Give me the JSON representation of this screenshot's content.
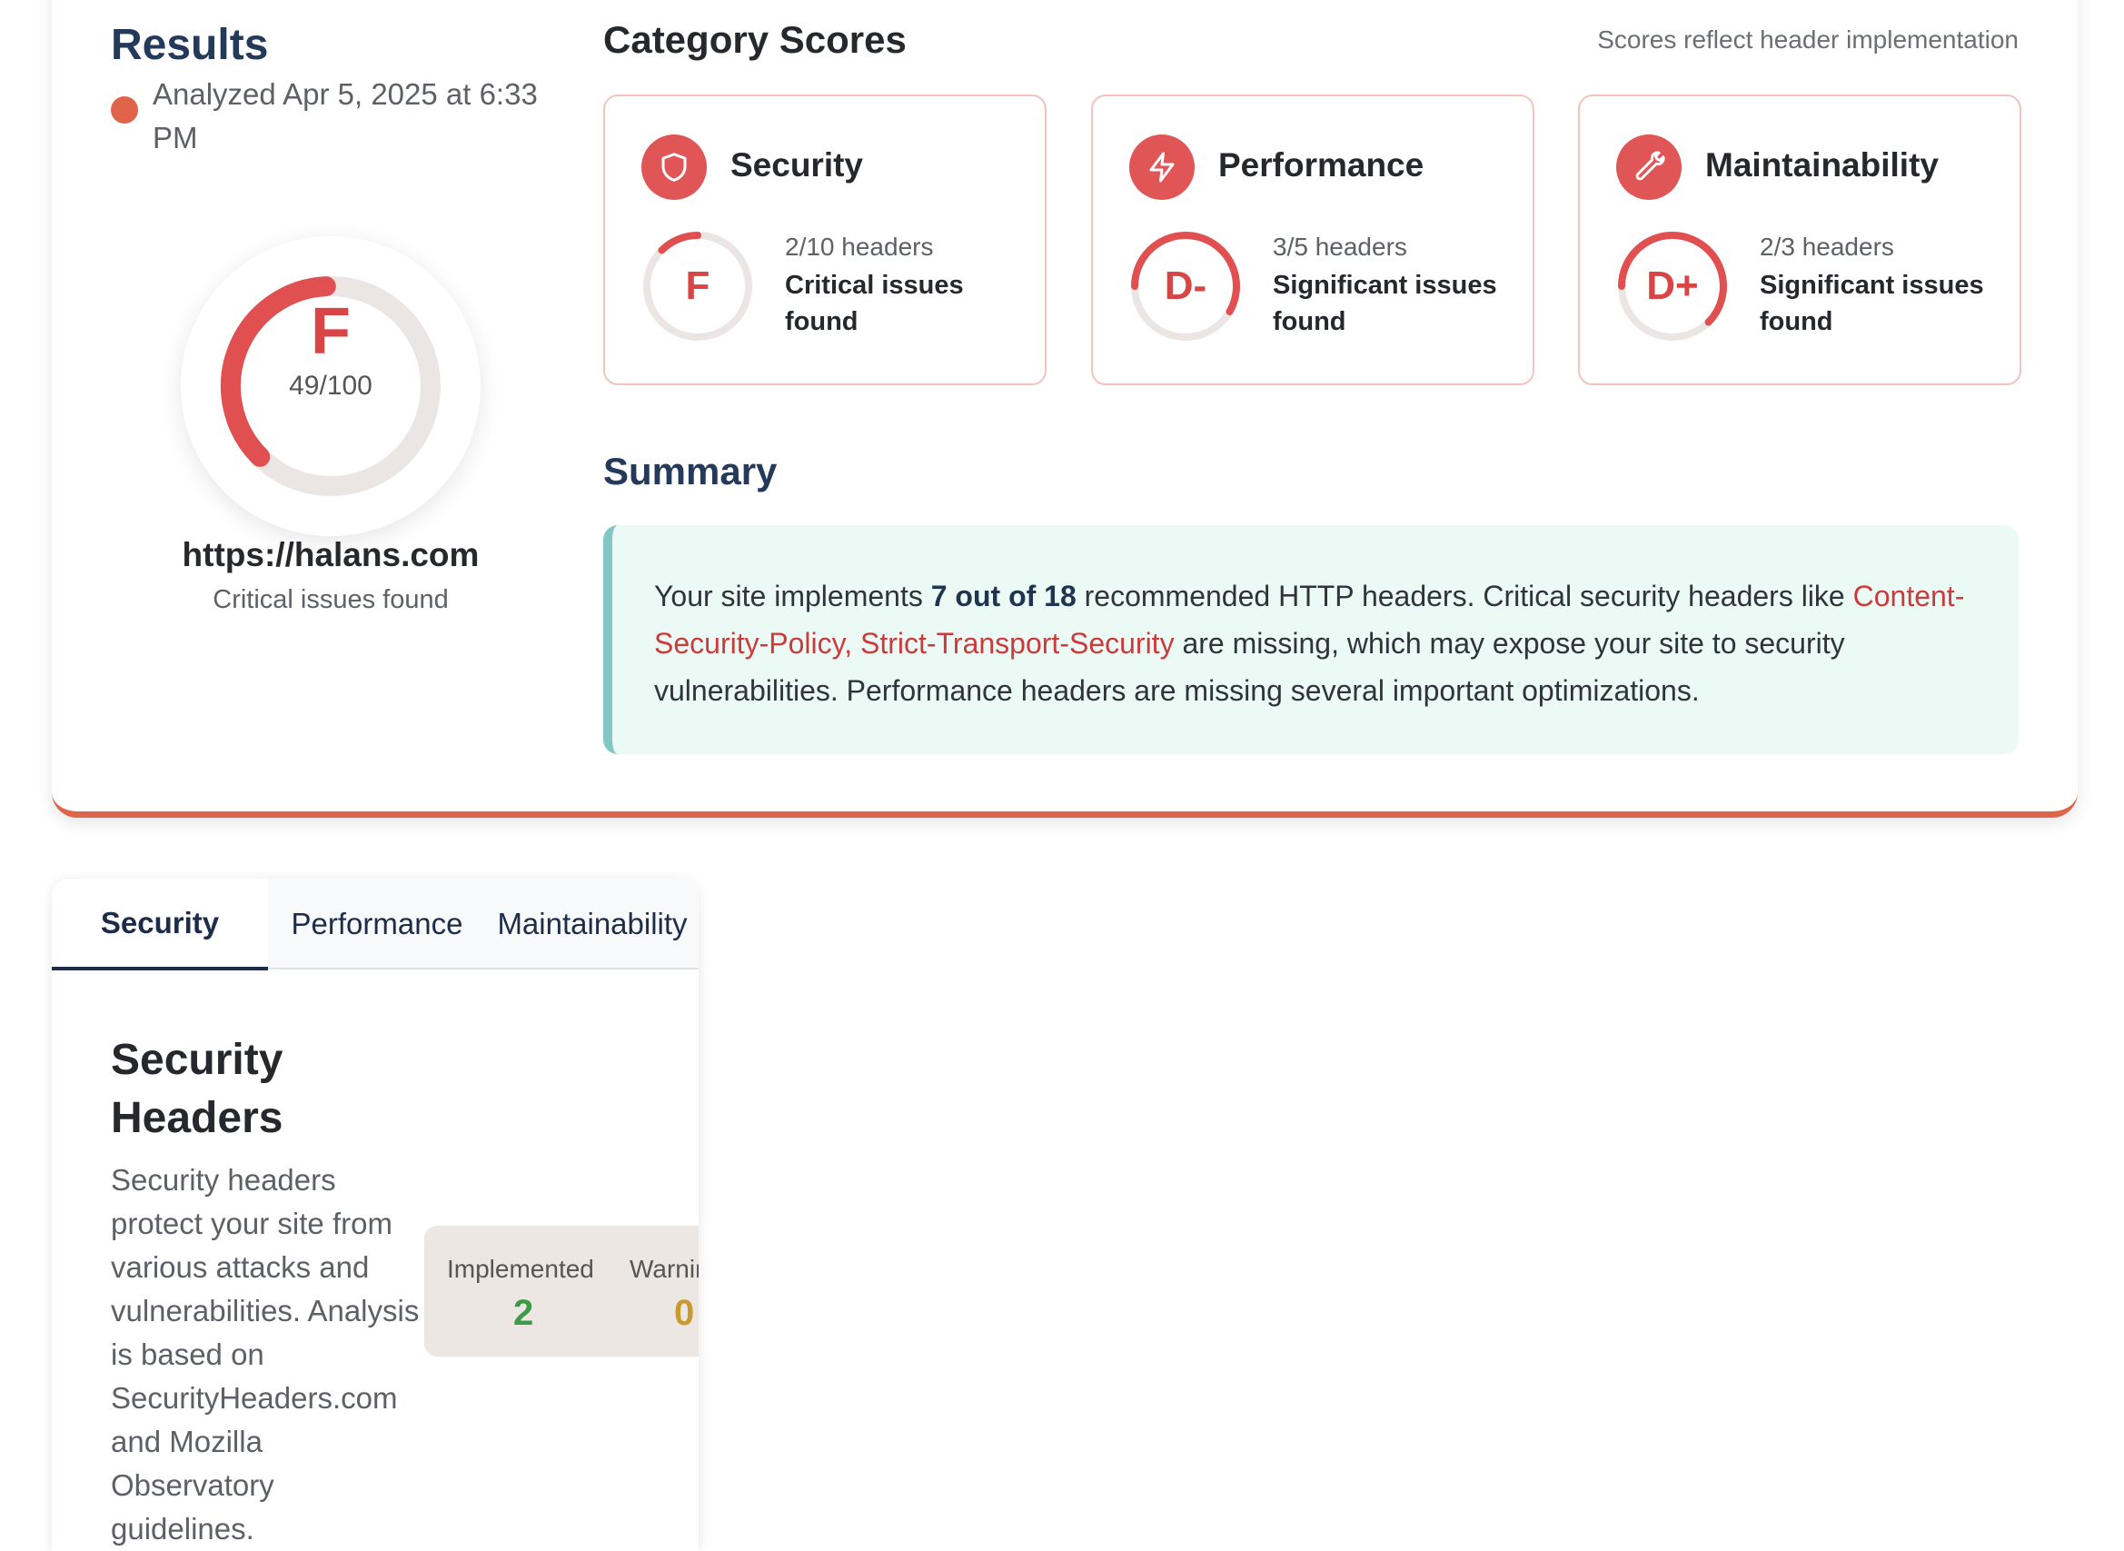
{
  "results": {
    "title": "Results",
    "analyzed": "Analyzed Apr 5, 2025 at 6:33 PM",
    "grade": "F",
    "score": "49/100",
    "score_value": 49,
    "url": "https://halans.com",
    "status": "Critical issues found"
  },
  "categories": {
    "heading": "Category Scores",
    "note": "Scores reflect header implementation",
    "items": [
      {
        "name": "Security",
        "icon": "shield-icon",
        "grade": "F",
        "count": "2/10 headers",
        "status": "Critical issues found"
      },
      {
        "name": "Performance",
        "icon": "lightning-icon",
        "grade": "D-",
        "count": "3/5 headers",
        "status": "Significant issues found"
      },
      {
        "name": "Maintainability",
        "icon": "wrench-icon",
        "grade": "D+",
        "count": "2/3 headers",
        "status": "Significant issues found"
      }
    ]
  },
  "summary": {
    "heading": "Summary",
    "text_1": "Your site implements ",
    "count": "7 out of 18",
    "text_2": " recommended HTTP headers. Critical security headers like ",
    "missing": "Content-Security-Policy, Strict-Transport-Security",
    "text_3": " are missing, which may expose your site to security vulnerabilities. Performance headers are missing several important optimizations."
  },
  "tabs": [
    {
      "label": "Security",
      "active": true
    },
    {
      "label": "Performance",
      "active": false
    },
    {
      "label": "Maintainability",
      "active": false
    }
  ],
  "security_section": {
    "title": "Security Headers",
    "description": "Security headers protect your site from various attacks and vulnerabilities. Analysis is based on SecurityHeaders.com and Mozilla Observatory guidelines.",
    "stats": [
      {
        "label": "Implemented",
        "value": "2"
      },
      {
        "label": "Warnings",
        "value": "0"
      }
    ]
  },
  "colors": {
    "accent": "#e0644a",
    "grade_red": "#d94545",
    "navy": "#1d2c48",
    "summary_bg": "#ebfaf4",
    "implemented_green": "#3f9a47",
    "warning_gold": "#c99a2e"
  }
}
